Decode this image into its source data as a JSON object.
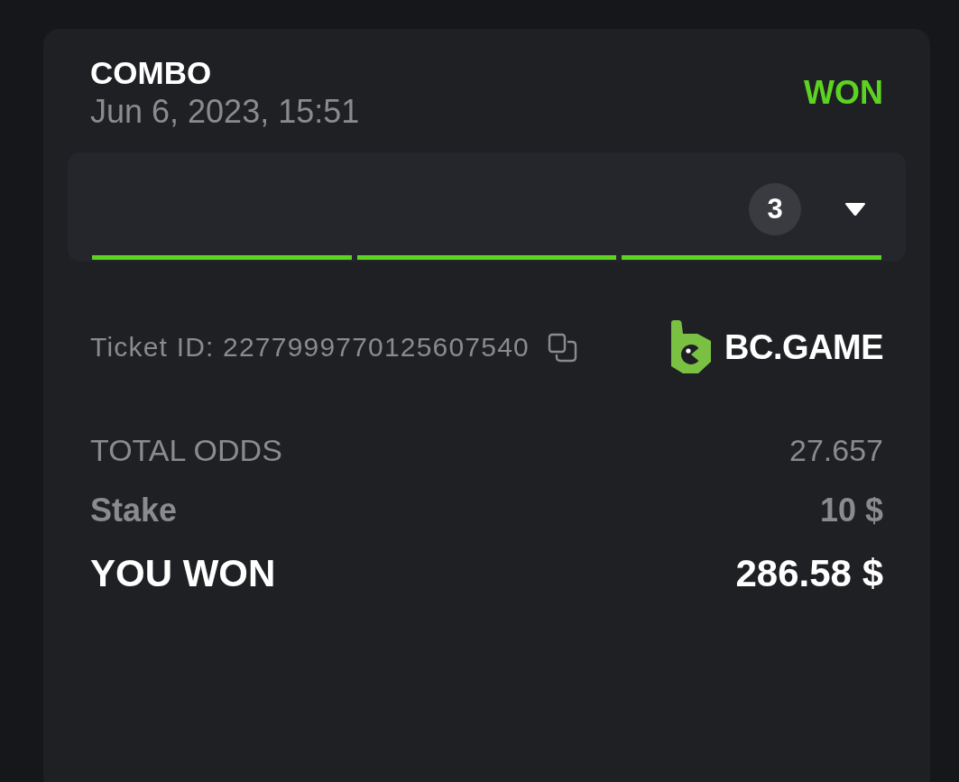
{
  "bet": {
    "type": "COMBO",
    "date": "Jun 6, 2023, 15:51",
    "status": {
      "kind": "won",
      "label": "WON"
    }
  },
  "legs_panel": {
    "count": "3",
    "expanded": false,
    "legs": [
      {
        "color": "#5dd321"
      },
      {
        "color": "#5dd321"
      },
      {
        "color": "#5dd321"
      }
    ]
  },
  "ticket": {
    "text": "Ticket ID: 2277999770125607540"
  },
  "brand": {
    "name": "BC.GAME"
  },
  "summary": [
    {
      "kind": "odds",
      "label": "TOTAL ODDS",
      "value": "27.657"
    },
    {
      "kind": "stake",
      "label": "Stake",
      "value": "10 $"
    },
    {
      "kind": "payout",
      "label": "YOU WON",
      "value": "286.58 $"
    }
  ]
}
